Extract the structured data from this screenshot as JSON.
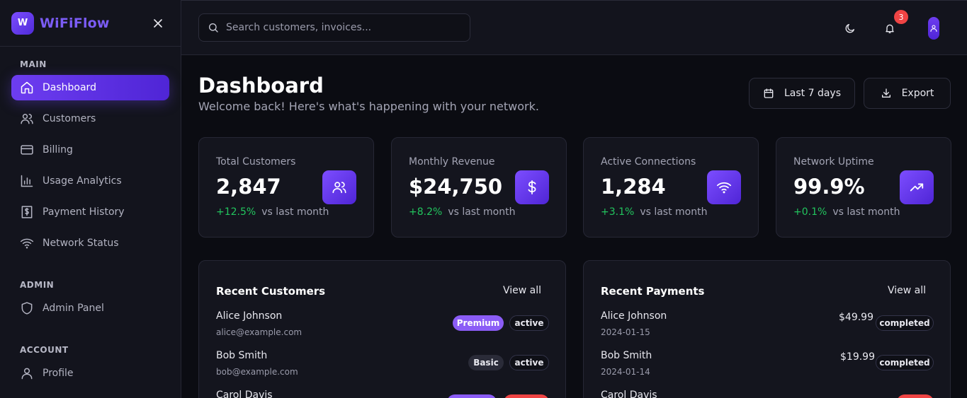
{
  "brand": {
    "logo_letter": "W",
    "name": "WiFiFlow"
  },
  "sidebar": {
    "sections": [
      {
        "title": "MAIN",
        "items": [
          {
            "label": "Dashboard",
            "icon": "home-icon",
            "active": true
          },
          {
            "label": "Customers",
            "icon": "users-icon"
          },
          {
            "label": "Billing",
            "icon": "credit-card-icon"
          },
          {
            "label": "Usage Analytics",
            "icon": "bar-chart-icon"
          },
          {
            "label": "Payment History",
            "icon": "receipt-icon"
          },
          {
            "label": "Network Status",
            "icon": "wifi-icon"
          }
        ]
      },
      {
        "title": "ADMIN",
        "items": [
          {
            "label": "Admin Panel",
            "icon": "shield-icon"
          }
        ]
      },
      {
        "title": "ACCOUNT",
        "items": [
          {
            "label": "Profile",
            "icon": "user-icon"
          }
        ]
      }
    ]
  },
  "topbar": {
    "search_placeholder": "Search customers, invoices...",
    "notification_count": "3"
  },
  "header": {
    "title": "Dashboard",
    "subtitle": "Welcome back! Here's what's happening with your network.",
    "date_range_label": "Last 7 days",
    "export_label": "Export"
  },
  "stats": [
    {
      "label": "Total Customers",
      "value": "2,847",
      "change": "+12.5%",
      "suffix": "vs last month",
      "icon": "users-icon"
    },
    {
      "label": "Monthly Revenue",
      "value": "$24,750",
      "change": "+8.2%",
      "suffix": "vs last month",
      "icon": "dollar-icon"
    },
    {
      "label": "Active Connections",
      "value": "1,284",
      "change": "+3.1%",
      "suffix": "vs last month",
      "icon": "wifi-icon"
    },
    {
      "label": "Network Uptime",
      "value": "99.9%",
      "change": "+0.1%",
      "suffix": "vs last month",
      "icon": "trending-up-icon"
    }
  ],
  "recent_customers": {
    "title": "Recent Customers",
    "view_all": "View all",
    "rows": [
      {
        "name": "Alice Johnson",
        "email": "alice@example.com",
        "plan": "Premium",
        "status": "active"
      },
      {
        "name": "Bob Smith",
        "email": "bob@example.com",
        "plan": "Basic",
        "status": "active"
      },
      {
        "name": "Carol Davis",
        "email": "",
        "plan": "",
        "status": ""
      }
    ]
  },
  "recent_payments": {
    "title": "Recent Payments",
    "view_all": "View all",
    "rows": [
      {
        "name": "Alice Johnson",
        "date": "2024-01-15",
        "amount": "$49.99",
        "status": "completed"
      },
      {
        "name": "Bob Smith",
        "date": "2024-01-14",
        "amount": "$19.99",
        "status": "completed"
      },
      {
        "name": "Carol Davis",
        "date": "",
        "amount": "",
        "status": ""
      }
    ]
  },
  "colors": {
    "accent": "#6d3df0",
    "positive": "#22c55e",
    "danger": "#ef4444",
    "background": "#0b0c12",
    "surface": "#14151e"
  }
}
